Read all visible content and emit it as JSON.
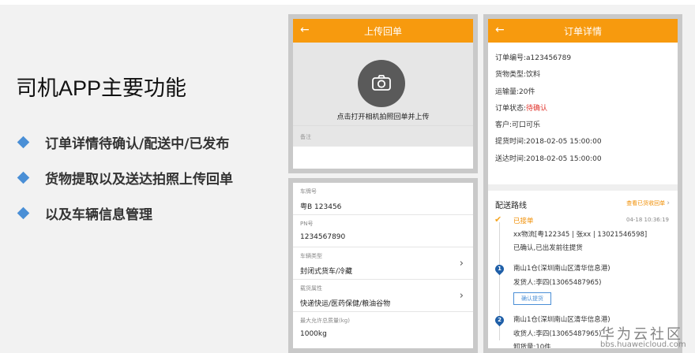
{
  "intro": {
    "title": "司机APP主要功能",
    "features": [
      "订单详情待确认/配送中/已发布",
      "货物提取以及送达拍照上传回单",
      "以及车辆信息管理"
    ]
  },
  "upload": {
    "title": "上传回单",
    "hint": "点击打开相机拍照回单并上传",
    "remark": "备注"
  },
  "vehicle": {
    "fields": [
      {
        "label": "车牌号",
        "value": "粤B 123456"
      },
      {
        "label": "PN号",
        "value": "1234567890"
      },
      {
        "label": "车辆类型",
        "value": "封闭式货车/冷藏"
      },
      {
        "label": "载货属性",
        "value": "快递快运/医药保健/粮油谷物"
      },
      {
        "label": "最大允许总质量(kg)",
        "value": "1000kg"
      }
    ]
  },
  "order": {
    "title": "订单详情",
    "order_no": "订单编号:a123456789",
    "cargo_type": "货物类型:饮料",
    "quantity": "运输量:20件",
    "status_label": "订单状态:",
    "status_value": "待确认",
    "customer": "客户:可口可乐",
    "pickup_time": "提货时间:2018-02-05 15:00:00",
    "delivery_time": "送达时间:2018-02-05 15:00:00",
    "route_title": "配送路线",
    "route_link": "查看已货收回单",
    "steps": {
      "accepted": "已接单",
      "accepted_time": "04-18 10:36:19",
      "carrier": "xx物流[粤122345 | 张xx | 13021546598]",
      "carrier_status": "已确认,已出发前往提货",
      "stop1_num": "1",
      "stop1_place": "南山1仓(深圳南山区清华信息港)",
      "stop1_person": "发货人:李四(13065487965)",
      "stop1_button": "确认提货",
      "stop2_num": "2",
      "stop2_place": "南山1仓(深圳南山区清华信息港)",
      "stop2_person": "收货人:李四(13065487965)",
      "stop2_qty": "卸货量:10件"
    }
  },
  "watermark": {
    "text": "华为云社区",
    "url": "bbs.huaweicloud.com"
  },
  "colors": {
    "accent": "#f79a0e",
    "bullet": "#4a8fd6",
    "status_red": "#e0332b",
    "pin_blue": "#1f5fa8"
  }
}
